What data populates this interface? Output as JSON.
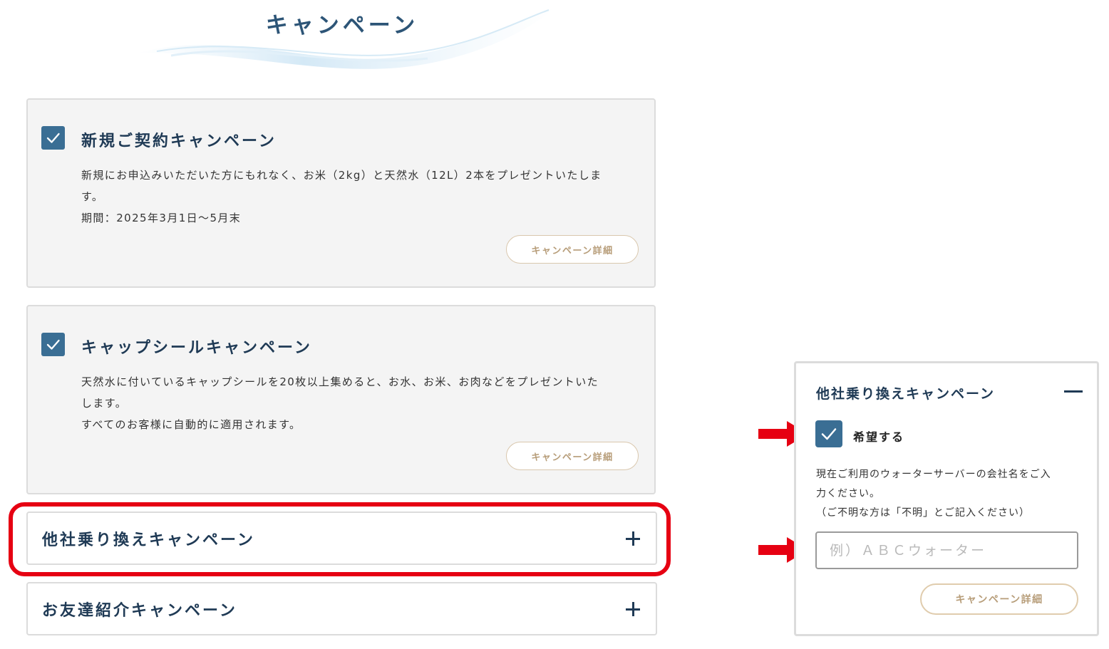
{
  "header": {
    "title": "キャンペーン"
  },
  "campaigns": [
    {
      "title": "新規ご契約キャンペーン",
      "checked": true,
      "description": [
        "新規にお申込みいただいた方にもれなく、お米（2kg）と天然水（12L）2本をプレゼントいたしま",
        "す。",
        "期間：2025年3月1日～5月末"
      ],
      "detail_label": "キャンペーン詳細"
    },
    {
      "title": "キャップシールキャンペーン",
      "checked": true,
      "description": [
        "天然水に付いているキャップシールを20枚以上集めると、お水、お米、お肉などをプレゼントいた",
        "します。",
        "すべてのお客様に自動的に適用されます。"
      ],
      "detail_label": "キャンペーン詳細"
    }
  ],
  "accordions": [
    {
      "title": "他社乗り換えキャンペーン",
      "icon": "plus-icon"
    },
    {
      "title": "お友達紹介キャンペーン",
      "icon": "plus-icon"
    }
  ],
  "expanded_panel": {
    "title": "他社乗り換えキャンペーン",
    "collapse_icon": "minus-icon",
    "checkbox_label": "希望する",
    "checked": true,
    "description": [
      "現在ご利用のウォーターサーバーの会社名をご入",
      "力ください。",
      "（ご不明な方は「不明」とご記入ください）"
    ],
    "input_placeholder": "例）ＡＢＣウォーター",
    "input_value": "",
    "detail_label": "キャンペーン詳細"
  },
  "colors": {
    "accent_blue": "#3a6e94",
    "title_navy": "#1f3a55",
    "highlight_red": "#e60012",
    "button_gold": "#b79d79"
  }
}
